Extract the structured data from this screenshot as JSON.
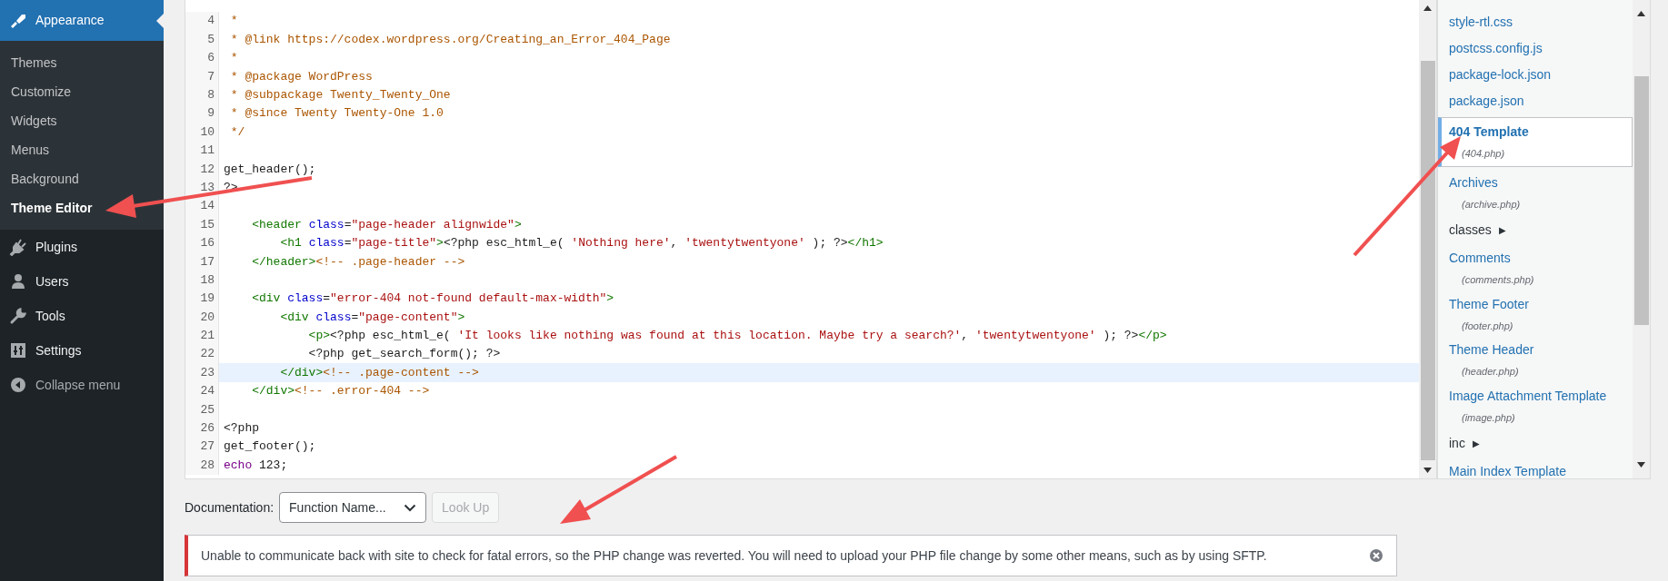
{
  "admin_menu": {
    "items": [
      {
        "label": "Appearance",
        "selected": true,
        "children": [
          {
            "label": "Themes",
            "selected": false
          },
          {
            "label": "Customize",
            "selected": false
          },
          {
            "label": "Widgets",
            "selected": false
          },
          {
            "label": "Menus",
            "selected": false
          },
          {
            "label": "Background",
            "selected": false
          },
          {
            "label": "Theme Editor",
            "selected": true
          }
        ]
      },
      {
        "label": "Plugins",
        "selected": false
      },
      {
        "label": "Users",
        "selected": false
      },
      {
        "label": "Tools",
        "selected": false
      },
      {
        "label": "Settings",
        "selected": false
      },
      {
        "label": "Collapse menu",
        "selected": false
      }
    ]
  },
  "code_editor": {
    "lines": [
      {
        "number": "4",
        "highlighted": false,
        "tokens": [
          {
            "kind": "comment",
            "text": " *"
          }
        ]
      },
      {
        "number": "5",
        "highlighted": false,
        "tokens": [
          {
            "kind": "comment",
            "text": " * @link https://codex.wordpress.org/Creating_an_Error_404_Page"
          }
        ]
      },
      {
        "number": "6",
        "highlighted": false,
        "tokens": [
          {
            "kind": "comment",
            "text": " *"
          }
        ]
      },
      {
        "number": "7",
        "highlighted": false,
        "tokens": [
          {
            "kind": "comment",
            "text": " * @package WordPress"
          }
        ]
      },
      {
        "number": "8",
        "highlighted": false,
        "tokens": [
          {
            "kind": "comment",
            "text": " * @subpackage Twenty_Twenty_One"
          }
        ]
      },
      {
        "number": "9",
        "highlighted": false,
        "tokens": [
          {
            "kind": "comment",
            "text": " * @since Twenty Twenty-One 1.0"
          }
        ]
      },
      {
        "number": "10",
        "highlighted": false,
        "tokens": [
          {
            "kind": "comment",
            "text": " */"
          }
        ]
      },
      {
        "number": "11",
        "highlighted": false
      },
      {
        "number": "12",
        "highlighted": false,
        "tokens": [
          {
            "kind": "plain",
            "text": "get_header();"
          }
        ]
      },
      {
        "number": "13",
        "highlighted": false,
        "tokens": [
          {
            "kind": "plain",
            "text": "?>"
          }
        ]
      },
      {
        "number": "14",
        "highlighted": false
      },
      {
        "number": "15",
        "highlighted": false,
        "tokens": [
          {
            "kind": "tag",
            "text": "    <header "
          },
          {
            "kind": "attribute",
            "text": "class"
          },
          {
            "kind": "plain",
            "text": "="
          },
          {
            "kind": "string",
            "text": "\"page-header alignwide\""
          },
          {
            "kind": "tag",
            "text": ">"
          }
        ]
      },
      {
        "number": "16",
        "highlighted": false,
        "tokens": [
          {
            "kind": "tag",
            "text": "        <h1 "
          },
          {
            "kind": "attribute",
            "text": "class"
          },
          {
            "kind": "plain",
            "text": "="
          },
          {
            "kind": "string",
            "text": "\"page-title\""
          },
          {
            "kind": "tag",
            "text": ">"
          },
          {
            "kind": "plain",
            "text": "<?php esc_html_e( "
          },
          {
            "kind": "string",
            "text": "'Nothing here'"
          },
          {
            "kind": "plain",
            "text": ", "
          },
          {
            "kind": "string",
            "text": "'twentytwentyone'"
          },
          {
            "kind": "plain",
            "text": " ); ?>"
          },
          {
            "kind": "tag",
            "text": "</h1>"
          }
        ]
      },
      {
        "number": "17",
        "highlighted": false,
        "tokens": [
          {
            "kind": "tag",
            "text": "    </header>"
          },
          {
            "kind": "comment",
            "text": "<!-- .page-header -->"
          }
        ]
      },
      {
        "number": "18",
        "highlighted": false
      },
      {
        "number": "19",
        "highlighted": false,
        "tokens": [
          {
            "kind": "tag",
            "text": "    <div "
          },
          {
            "kind": "attribute",
            "text": "class"
          },
          {
            "kind": "plain",
            "text": "="
          },
          {
            "kind": "string",
            "text": "\"error-404 not-found default-max-width\""
          },
          {
            "kind": "tag",
            "text": ">"
          }
        ]
      },
      {
        "number": "20",
        "highlighted": false,
        "tokens": [
          {
            "kind": "tag",
            "text": "        <div "
          },
          {
            "kind": "attribute",
            "text": "class"
          },
          {
            "kind": "plain",
            "text": "="
          },
          {
            "kind": "string",
            "text": "\"page-content\""
          },
          {
            "kind": "tag",
            "text": ">"
          }
        ]
      },
      {
        "number": "21",
        "highlighted": false,
        "tokens": [
          {
            "kind": "tag",
            "text": "            <p>"
          },
          {
            "kind": "plain",
            "text": "<?php esc_html_e( "
          },
          {
            "kind": "string",
            "text": "'It looks like nothing was found at this location. Maybe try a search?'"
          },
          {
            "kind": "plain",
            "text": ", "
          },
          {
            "kind": "string",
            "text": "'twentytwentyone'"
          },
          {
            "kind": "plain",
            "text": " ); ?>"
          },
          {
            "kind": "tag",
            "text": "</p>"
          }
        ]
      },
      {
        "number": "22",
        "highlighted": false,
        "tokens": [
          {
            "kind": "plain",
            "text": "            <?php get_search_form(); ?>"
          }
        ]
      },
      {
        "number": "23",
        "highlighted": true,
        "tokens": [
          {
            "kind": "tag",
            "text": "        </div>"
          },
          {
            "kind": "comment",
            "text": "<!-- .page-content -->"
          }
        ]
      },
      {
        "number": "24",
        "highlighted": false,
        "tokens": [
          {
            "kind": "tag",
            "text": "    </div>"
          },
          {
            "kind": "comment",
            "text": "<!-- .error-404 -->"
          }
        ]
      },
      {
        "number": "25",
        "highlighted": false
      },
      {
        "number": "26",
        "highlighted": false,
        "tokens": [
          {
            "kind": "plain",
            "text": "<?php"
          }
        ]
      },
      {
        "number": "27",
        "highlighted": false,
        "tokens": [
          {
            "kind": "plain",
            "text": "get_footer();"
          }
        ]
      },
      {
        "number": "28",
        "highlighted": false,
        "tokens": [
          {
            "kind": "keyword",
            "text": "echo"
          },
          {
            "kind": "plain",
            "text": " 123;"
          }
        ]
      }
    ]
  },
  "theme_files": {
    "items": [
      {
        "kind": "file",
        "name": "style-rtl.css",
        "selected": false
      },
      {
        "kind": "file",
        "name": "postcss.config.js",
        "selected": false
      },
      {
        "kind": "file",
        "name": "package-lock.json",
        "selected": false
      },
      {
        "kind": "file",
        "name": "package.json",
        "selected": false
      },
      {
        "kind": "file",
        "name": "404 Template",
        "file": "(404.php)",
        "selected": true
      },
      {
        "kind": "file",
        "name": "Archives",
        "file": "(archive.php)",
        "selected": false
      },
      {
        "kind": "folder",
        "name": "classes",
        "toggle": "▶",
        "selected": false
      },
      {
        "kind": "file",
        "name": "Comments",
        "file": "(comments.php)",
        "selected": false
      },
      {
        "kind": "file",
        "name": "Theme Footer",
        "file": "(footer.php)",
        "selected": false
      },
      {
        "kind": "file",
        "name": "Theme Header",
        "file": "(header.php)",
        "selected": false
      },
      {
        "kind": "file",
        "name": "Image Attachment Template",
        "file": "(image.php)",
        "selected": false
      },
      {
        "kind": "folder",
        "name": "inc",
        "toggle": "▶",
        "selected": false
      },
      {
        "kind": "file",
        "name": "Main Index Template",
        "selected": false
      }
    ]
  },
  "documentation": {
    "label": "Documentation:",
    "select_value": "Function Name...",
    "button": {
      "label": "Look Up",
      "disabled": true
    }
  },
  "notice": {
    "message": "Unable to communicate back with site to check for fatal errors, so the PHP change was reverted. You will need to upload your PHP file change by some other means, such as by using SFTP."
  }
}
